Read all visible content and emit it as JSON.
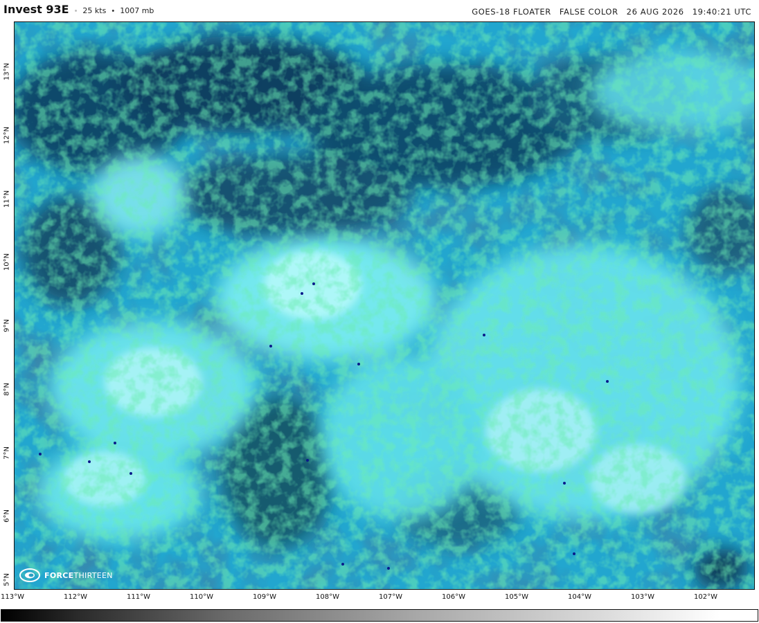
{
  "header": {
    "storm_name": "Invest 93E",
    "intensity": "25 kts",
    "pressure": "1007 mb",
    "satellite": "GOES-18 FLOATER",
    "product": "FALSE COLOR",
    "date": "26 AUG 2026",
    "time": "19:40:21 UTC"
  },
  "map": {
    "latitudes": [
      "13°N",
      "12°N",
      "11°N",
      "10°N",
      "9°N",
      "8°N",
      "7°N",
      "6°N",
      "5°N"
    ],
    "longitudes": [
      "113°W",
      "112°W",
      "111°W",
      "110°W",
      "109°W",
      "108°W",
      "107°W",
      "106°W",
      "105°W",
      "104°W",
      "103°W",
      "102°W"
    ]
  },
  "logo": {
    "bold": "FORCE",
    "light": "THIRTEEN"
  },
  "colors": {
    "deep": "#0d3a5c",
    "mid": "#1f7fb0",
    "cyan": "#3fe0e6",
    "green": "#2fbf6a",
    "bright": "#a9f4f4"
  },
  "colorbar": {
    "start": "#000000",
    "end": "#ffffff"
  }
}
